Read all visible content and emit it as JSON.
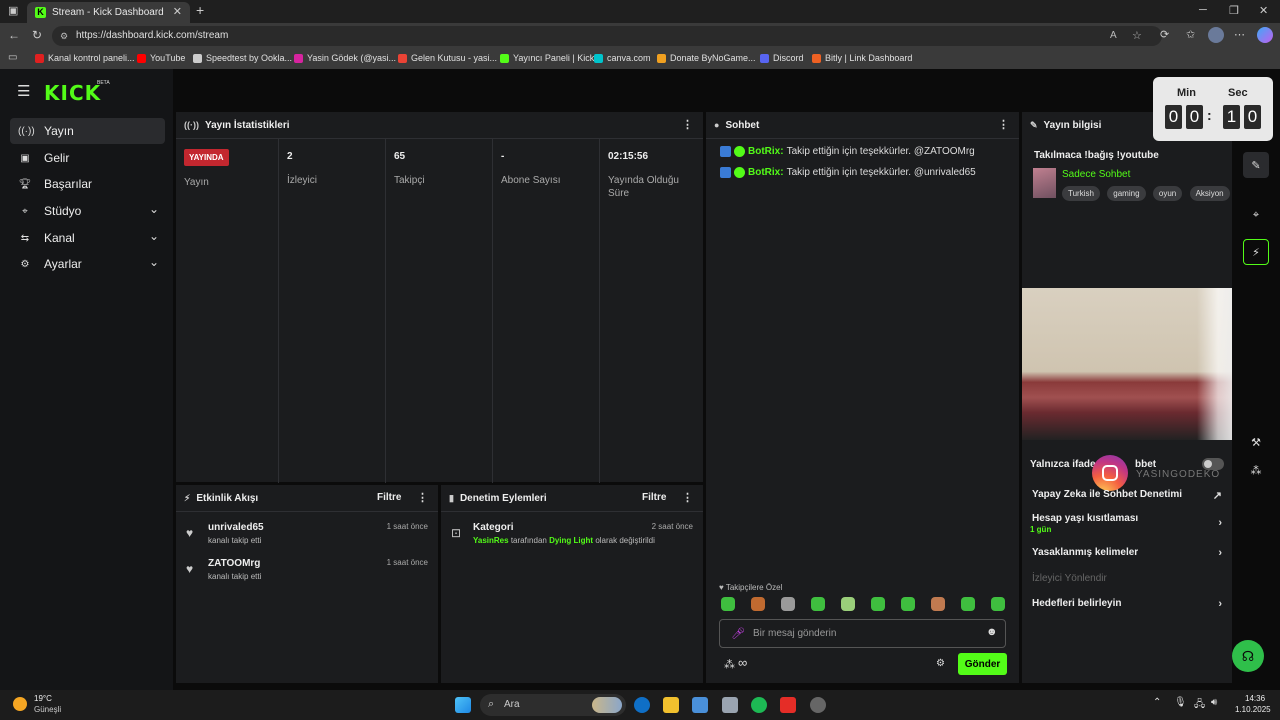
{
  "browser": {
    "tab_title": "Stream - Kick Dashboard",
    "new_tab": "+",
    "url": "https://dashboard.kick.com/stream",
    "bookmarks": [
      {
        "label": "Kanal kontrol paneli...",
        "color": "#e02020"
      },
      {
        "label": "YouTube",
        "color": "#ff0000"
      },
      {
        "label": "Speedtest by Ookla...",
        "color": "#cccccc"
      },
      {
        "label": "Yasin Gödek (@yasi...",
        "color": "#d6249f"
      },
      {
        "label": "Gelen Kutusu - yasi...",
        "color": "#ea4335"
      },
      {
        "label": "Yayıncı Paneli | Kick",
        "color": "#53fc18"
      },
      {
        "label": "canva.com",
        "color": "#00c4cc"
      },
      {
        "label": "Donate ByNoGame...",
        "color": "#f0a020"
      },
      {
        "label": "Discord",
        "color": "#5865f2"
      },
      {
        "label": "Bitly | Link Dashboard",
        "color": "#ee6123"
      }
    ]
  },
  "nav": {
    "logo": "KICK",
    "logo_beta": "BETA",
    "items": [
      {
        "label": "Yayın",
        "icon": "broadcast-icon"
      },
      {
        "label": "Gelir",
        "icon": "money-icon"
      },
      {
        "label": "Başarılar",
        "icon": "trophy-icon"
      },
      {
        "label": "Stüdyo",
        "icon": "studio-icon"
      },
      {
        "label": "Kanal",
        "icon": "channel-icon"
      },
      {
        "label": "Ayarlar",
        "icon": "gear-icon"
      }
    ]
  },
  "stats": {
    "title": "Yayın İstatistikleri",
    "live_badge": "YAYINDA",
    "columns": [
      {
        "value": "",
        "label": "Yayın"
      },
      {
        "value": "2",
        "label": "İzleyici"
      },
      {
        "value": "65",
        "label": "Takipçi"
      },
      {
        "value": "-",
        "label": "Abone Sayısı"
      },
      {
        "value": "02:15:56",
        "label": "Yayında Olduğu Süre"
      }
    ]
  },
  "chat": {
    "title": "Sohbet",
    "messages": [
      {
        "user": "BotRix:",
        "text": "Takip ettiğin için teşekkürler. @ZATOOMrg"
      },
      {
        "user": "BotRix:",
        "text": "Takip ettiğin için teşekkürler. @unrivaled65"
      }
    ],
    "followers_only": "Takipçilere Özel",
    "placeholder": "Bir mesaj gönderin",
    "send": "Gönder"
  },
  "activity": {
    "title": "Etkinlik Akışı",
    "filter": "Filtre",
    "events": [
      {
        "name": "unrivaled65",
        "sub": "kanalı takip etti",
        "time": "1 saat önce"
      },
      {
        "name": "ZATOOMrg",
        "sub": "kanalı takip etti",
        "time": "1 saat önce"
      }
    ]
  },
  "moderation": {
    "title": "Denetim Eylemleri",
    "filter": "Filtre",
    "item_title": "Kategori",
    "item_time": "2 saat önce",
    "item_user": "YasinRes",
    "item_mid": "tarafından",
    "item_game": "Dying Light",
    "item_end": "olarak değiştirildi"
  },
  "info": {
    "title": "Yayın bilgisi",
    "stream_title": "Takılmaca !bağış !youtube",
    "chat_mode": "Sadece Sohbet",
    "tags": [
      "Turkish",
      "gaming",
      "oyun",
      "Aksiyon"
    ],
    "emote_only": "Yalnızca ifade",
    "emote_only_end": "bbet",
    "watermark": "YASINGODEKO",
    "ai_mod": "Yapay Zeka ile Sohbet Denetimi",
    "account_age": "Hesap yaşı kısıtlaması",
    "account_age_val": "1 gün",
    "banned_words": "Yasaklanmış kelimeler",
    "viewer_dir": "İzleyici Yönlendir",
    "goals": "Hedefleri belirleyin"
  },
  "timer": {
    "min_label": "Min",
    "sec_label": "Sec",
    "digits": [
      "0",
      "0",
      "1",
      "0"
    ]
  },
  "taskbar": {
    "weather_temp": "19°C",
    "weather_desc": "Güneşli",
    "search": "Ara",
    "time": "14:36",
    "date": "1.10.2025"
  }
}
